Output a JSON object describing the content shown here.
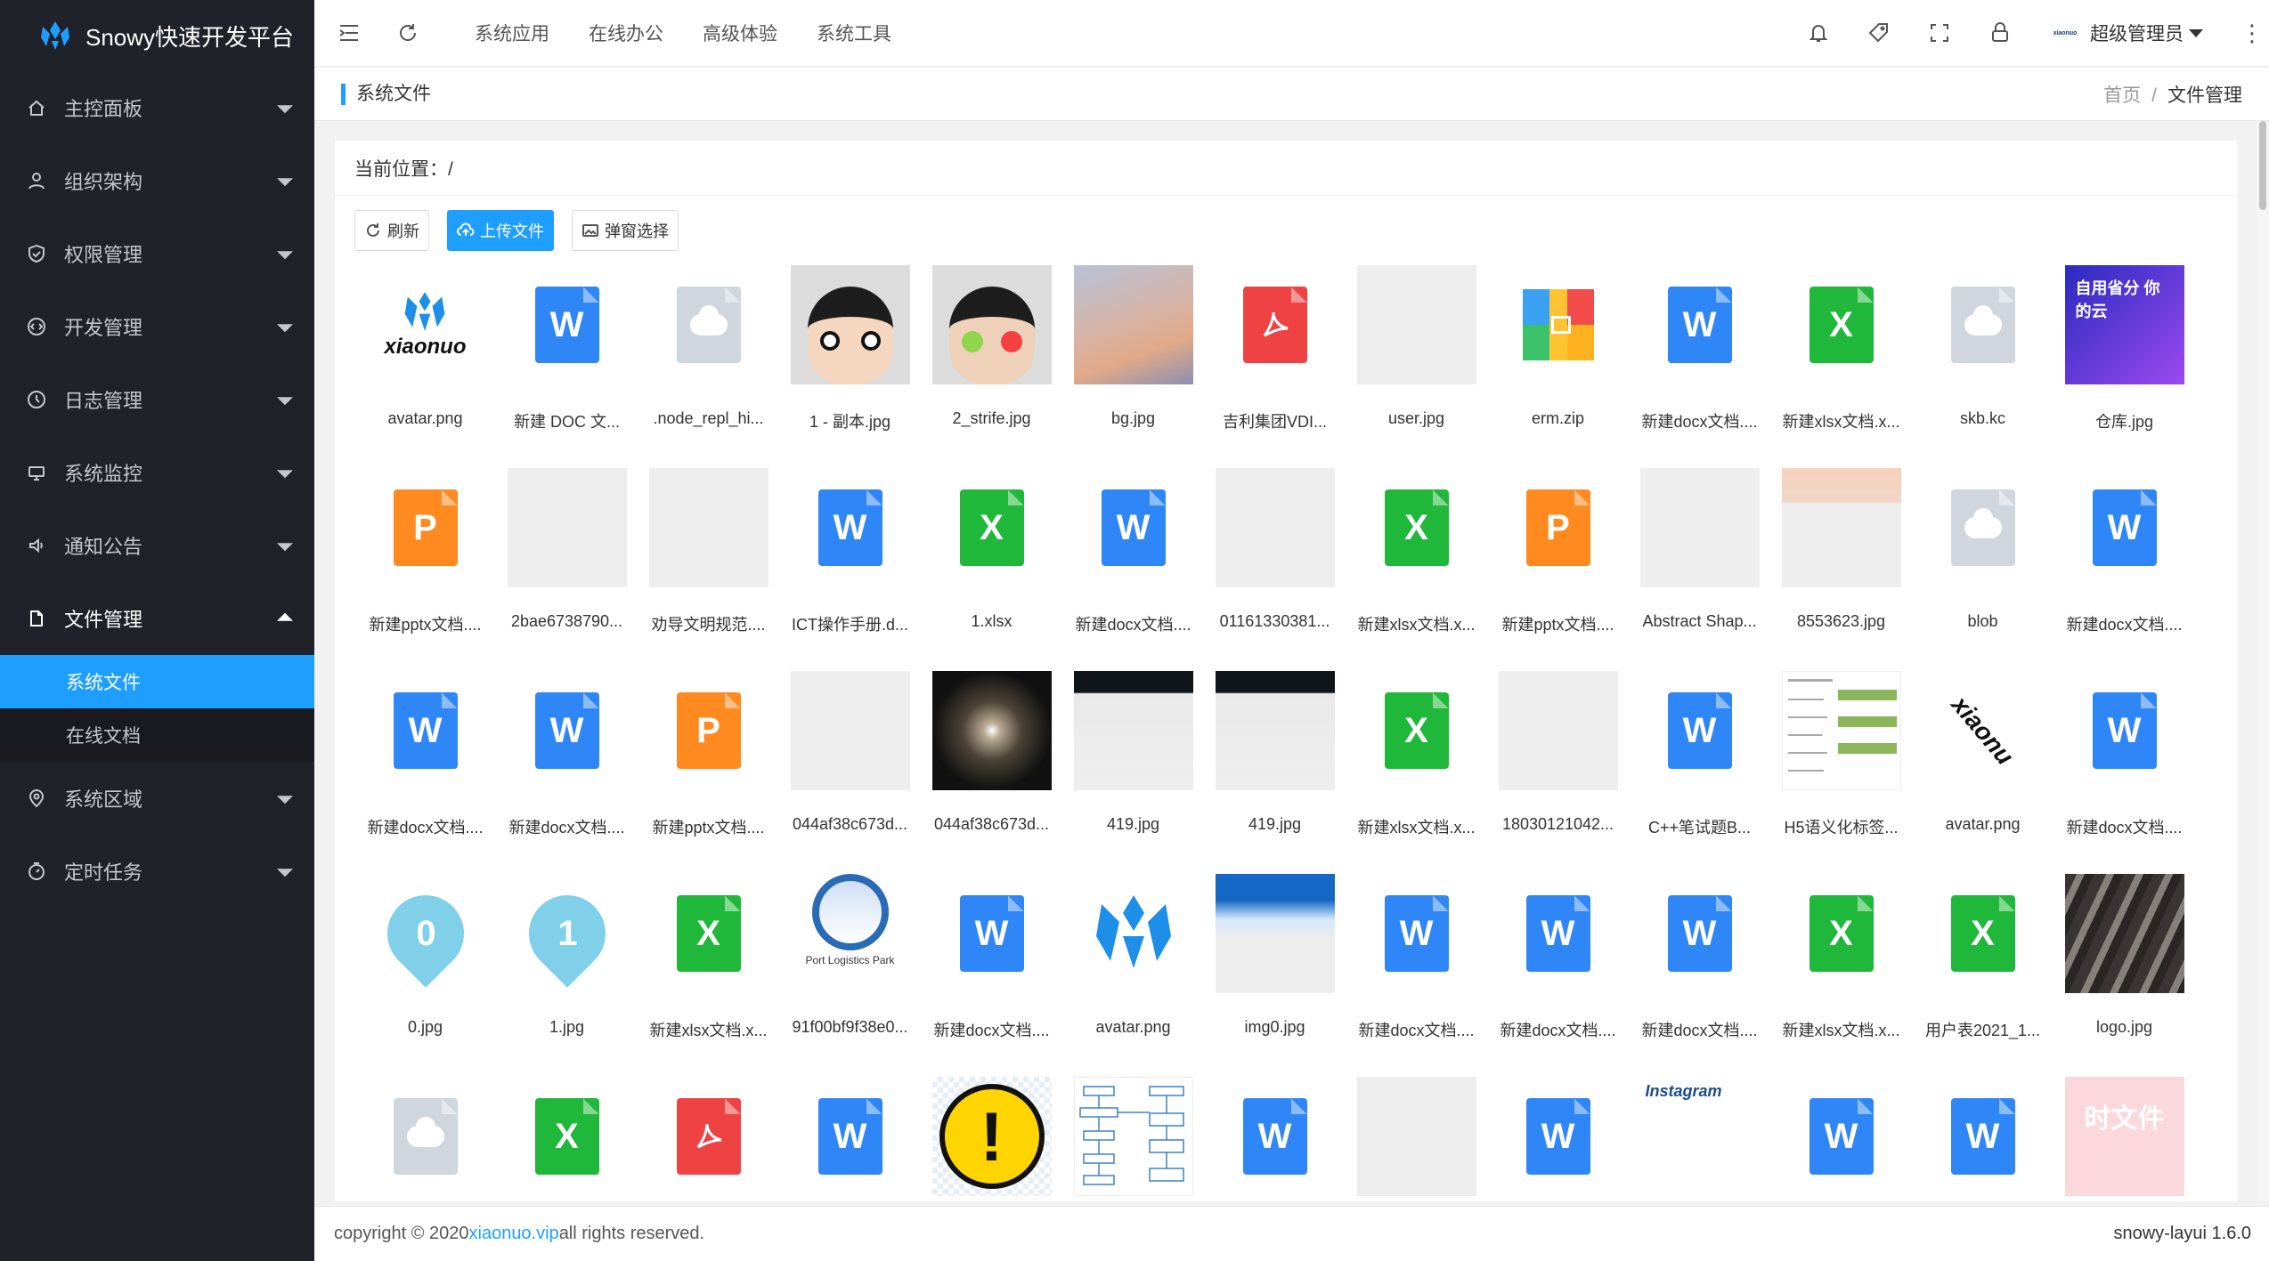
{
  "app": {
    "title": "Snowy快速开发平台"
  },
  "sidebar": {
    "items": [
      {
        "label": "主控面板",
        "icon": "home-icon"
      },
      {
        "label": "组织架构",
        "icon": "user-icon"
      },
      {
        "label": "权限管理",
        "icon": "shield-icon"
      },
      {
        "label": "开发管理",
        "icon": "code-icon"
      },
      {
        "label": "日志管理",
        "icon": "clock-icon"
      },
      {
        "label": "系统监控",
        "icon": "monitor-icon"
      },
      {
        "label": "通知公告",
        "icon": "speaker-icon"
      },
      {
        "label": "文件管理",
        "icon": "file-icon",
        "open": true
      },
      {
        "label": "系统区域",
        "icon": "location-icon"
      },
      {
        "label": "定时任务",
        "icon": "timer-icon"
      }
    ],
    "sub_items": [
      {
        "label": "系统文件",
        "active": true
      },
      {
        "label": "在线文档",
        "active": false
      }
    ]
  },
  "header": {
    "menus": [
      "系统应用",
      "在线办公",
      "高级体验",
      "系统工具"
    ],
    "user_name": "超级管理员",
    "avatar_text": "xiaonuo",
    "more": "⋮"
  },
  "tabbar": {
    "title": "系统文件",
    "breadcrumb_home": "首页",
    "breadcrumb_sep": "/",
    "breadcrumb_current": "文件管理"
  },
  "content": {
    "location": "当前位置：/",
    "buttons": {
      "refresh": "刷新",
      "upload": "上传文件",
      "popup": "弹窗选择"
    }
  },
  "files": [
    {
      "name": "avatar.png",
      "kind": "xnlogo"
    },
    {
      "name": "新建 DOC 文...",
      "kind": "w"
    },
    {
      "name": ".node_repl_hi...",
      "kind": "cloud"
    },
    {
      "name": "1 - 副本.jpg",
      "kind": "face1"
    },
    {
      "name": "2_strife.jpg",
      "kind": "face2"
    },
    {
      "name": "bg.jpg",
      "kind": "blur"
    },
    {
      "name": "吉利集团VDI...",
      "kind": "pdf"
    },
    {
      "name": "user.jpg",
      "kind": "ph"
    },
    {
      "name": "erm.zip",
      "kind": "zip"
    },
    {
      "name": "新建docx文档....",
      "kind": "w"
    },
    {
      "name": "新建xlsx文档.x...",
      "kind": "x"
    },
    {
      "name": "skb.kc",
      "kind": "cloud"
    },
    {
      "name": "仓库.jpg",
      "kind": "purple",
      "text": "自用省分 你的云"
    },
    {
      "name": "新建pptx文档....",
      "kind": "p"
    },
    {
      "name": "2bae6738790...",
      "kind": "ph"
    },
    {
      "name": "劝导文明规范....",
      "kind": "ph"
    },
    {
      "name": "ICT操作手册.d...",
      "kind": "w"
    },
    {
      "name": "1.xlsx",
      "kind": "x"
    },
    {
      "name": "新建docx文档....",
      "kind": "w"
    },
    {
      "name": "01161330381...",
      "kind": "ph"
    },
    {
      "name": "新建xlsx文档.x...",
      "kind": "x"
    },
    {
      "name": "新建pptx文档....",
      "kind": "p"
    },
    {
      "name": "Abstract Shap...",
      "kind": "ph"
    },
    {
      "name": "8553623.jpg",
      "kind": "peach"
    },
    {
      "name": "blob",
      "kind": "cloud"
    },
    {
      "name": "新建docx文档....",
      "kind": "w"
    },
    {
      "name": "新建docx文档....",
      "kind": "w"
    },
    {
      "name": "新建docx文档....",
      "kind": "w"
    },
    {
      "name": "新建pptx文档....",
      "kind": "p"
    },
    {
      "name": "044af38c673d...",
      "kind": "ph"
    },
    {
      "name": "044af38c673d...",
      "kind": "galaxy"
    },
    {
      "name": "419.jpg",
      "kind": "darktop"
    },
    {
      "name": "419.jpg",
      "kind": "darktop"
    },
    {
      "name": "新建xlsx文档.x...",
      "kind": "x"
    },
    {
      "name": "18030121042...",
      "kind": "ph"
    },
    {
      "name": "C++笔试题B...",
      "kind": "w"
    },
    {
      "name": "H5语义化标签...",
      "kind": "sheet"
    },
    {
      "name": "avatar.png",
      "kind": "xnrot"
    },
    {
      "name": "新建docx文档....",
      "kind": "w"
    },
    {
      "name": "0.jpg",
      "kind": "pin",
      "text": "0"
    },
    {
      "name": "1.jpg",
      "kind": "pin",
      "text": "1"
    },
    {
      "name": "新建xlsx文档.x...",
      "kind": "x"
    },
    {
      "name": "91f00bf9f38e0...",
      "kind": "port",
      "text": "Port Logistics Park"
    },
    {
      "name": "新建docx文档....",
      "kind": "w"
    },
    {
      "name": "avatar.png",
      "kind": "bluelogo"
    },
    {
      "name": "img0.jpg",
      "kind": "bluetop"
    },
    {
      "name": "新建docx文档....",
      "kind": "w"
    },
    {
      "name": "新建docx文档....",
      "kind": "w"
    },
    {
      "name": "新建docx文档....",
      "kind": "w"
    },
    {
      "name": "新建xlsx文档.x...",
      "kind": "x"
    },
    {
      "name": "用户表2021_1...",
      "kind": "x"
    },
    {
      "name": "logo.jpg",
      "kind": "crowd"
    },
    {
      "name": "",
      "kind": "cloud"
    },
    {
      "name": "",
      "kind": "x"
    },
    {
      "name": "",
      "kind": "pdf"
    },
    {
      "name": "",
      "kind": "w"
    },
    {
      "name": "",
      "kind": "alert"
    },
    {
      "name": "",
      "kind": "flow"
    },
    {
      "name": "",
      "kind": "w"
    },
    {
      "name": "",
      "kind": "ph"
    },
    {
      "name": "",
      "kind": "w"
    },
    {
      "name": "",
      "kind": "insta",
      "text": "Instagram"
    },
    {
      "name": "",
      "kind": "w"
    },
    {
      "name": "",
      "kind": "w"
    },
    {
      "name": "",
      "kind": "pink",
      "text": "时文件"
    }
  ],
  "footer": {
    "copyright_prefix": "copyright © 2020 ",
    "link": "xiaonuo.vip",
    "copyright_suffix": " all rights reserved.",
    "version": "snowy-layui 1.6.0"
  },
  "colors": {
    "accent": "#1e9fff",
    "sidebar_bg": "#20222a",
    "word": "#2f86f6",
    "excel": "#1fb83a",
    "ppt": "#ff8a1f",
    "pdf": "#ef4343"
  }
}
